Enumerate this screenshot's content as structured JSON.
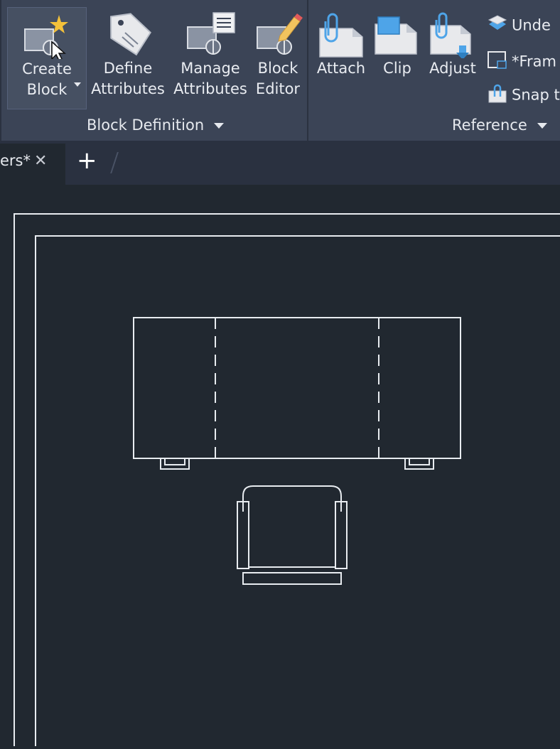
{
  "ribbon": {
    "block_definition": {
      "panel_label": "Block Definition",
      "tools": [
        {
          "line1": "Create",
          "line2": "Block"
        },
        {
          "line1": "Define",
          "line2": "Attributes"
        },
        {
          "line1": "Manage",
          "line2": "Attributes"
        },
        {
          "line1": "Block",
          "line2": "Editor"
        }
      ]
    },
    "reference": {
      "panel_label": "Reference",
      "tools": [
        {
          "label": "Attach"
        },
        {
          "label": "Clip"
        },
        {
          "label": "Adjust"
        }
      ],
      "small_tools": [
        {
          "label": "Unde"
        },
        {
          "label": "*Fram"
        },
        {
          "label": "Snap t"
        }
      ]
    }
  },
  "tabs": {
    "active_label": "ers*",
    "close_glyph": "✕",
    "new_tab_glyph": "+"
  },
  "colors": {
    "ribbon_bg": "#3b4456",
    "canvas_bg": "#212830",
    "line": "#e8ecf0"
  }
}
